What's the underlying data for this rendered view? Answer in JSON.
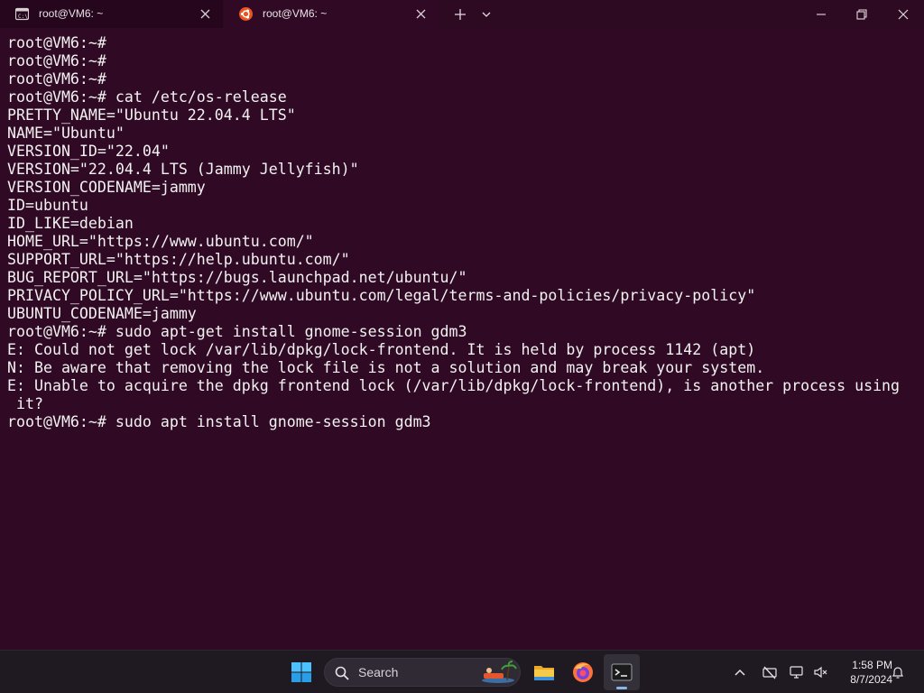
{
  "tabs": [
    {
      "label": "root@VM6: ~",
      "icon": "cmd-icon",
      "active": false
    },
    {
      "label": "root@VM6: ~",
      "icon": "ubuntu-icon",
      "active": true
    }
  ],
  "terminal": {
    "background": "#300a24",
    "foreground": "#f2f2f2",
    "lines": [
      "root@VM6:~#",
      "root@VM6:~#",
      "root@VM6:~#",
      "root@VM6:~# cat /etc/os-release",
      "PRETTY_NAME=\"Ubuntu 22.04.4 LTS\"",
      "NAME=\"Ubuntu\"",
      "VERSION_ID=\"22.04\"",
      "VERSION=\"22.04.4 LTS (Jammy Jellyfish)\"",
      "VERSION_CODENAME=jammy",
      "ID=ubuntu",
      "ID_LIKE=debian",
      "HOME_URL=\"https://www.ubuntu.com/\"",
      "SUPPORT_URL=\"https://help.ubuntu.com/\"",
      "BUG_REPORT_URL=\"https://bugs.launchpad.net/ubuntu/\"",
      "PRIVACY_POLICY_URL=\"https://www.ubuntu.com/legal/terms-and-policies/privacy-policy\"",
      "UBUNTU_CODENAME=jammy",
      "root@VM6:~# sudo apt-get install gnome-session gdm3",
      "E: Could not get lock /var/lib/dpkg/lock-frontend. It is held by process 1142 (apt)",
      "N: Be aware that removing the lock file is not a solution and may break your system.",
      "E: Unable to acquire the dpkg frontend lock (/var/lib/dpkg/lock-frontend), is another process using",
      " it?",
      "root@VM6:~# sudo apt install gnome-session gdm3"
    ]
  },
  "taskbar": {
    "search_placeholder": "Search",
    "apps": [
      "start-icon",
      "file-explorer-icon",
      "firefox-icon",
      "terminal-icon"
    ],
    "tray": [
      "chevron-up-icon",
      "network-off-icon",
      "display-icon",
      "volume-muted-icon",
      "notification-bell-icon"
    ],
    "time": "1:58 PM",
    "date": "8/7/2024"
  }
}
